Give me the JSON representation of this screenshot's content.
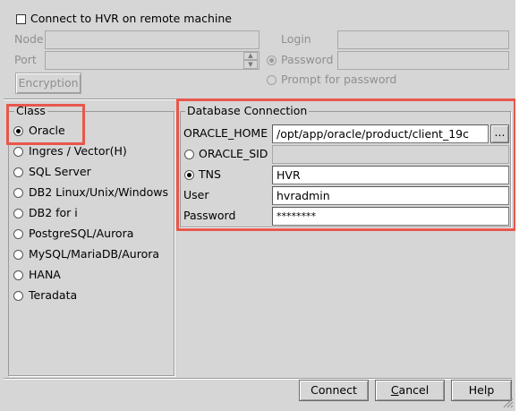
{
  "remote": {
    "connect_checkbox_label": "Connect to HVR on remote machine",
    "connect_checked": false,
    "node_label": "Node",
    "node_value": "",
    "port_label": "Port",
    "port_value": "",
    "login_label": "Login",
    "login_value": "",
    "password_label": "Password",
    "password_value": "",
    "prompt_label": "Prompt for password",
    "encryption_button": "Encryption"
  },
  "class_group": {
    "title": "Class",
    "selected": "Oracle",
    "options": [
      "Oracle",
      "Ingres / Vector(H)",
      "SQL Server",
      "DB2 Linux/Unix/Windows",
      "DB2 for i",
      "PostgreSQL/Aurora",
      "MySQL/MariaDB/Aurora",
      "HANA",
      "Teradata"
    ]
  },
  "db_connection": {
    "title": "Database Connection",
    "oracle_home_label": "ORACLE_HOME",
    "oracle_home_value": "/opt/app/oracle/product/client_19c",
    "browse_button": "...",
    "oracle_sid_label": "ORACLE_SID",
    "oracle_sid_value": "",
    "tns_label": "TNS",
    "tns_value": "HVR",
    "user_label": "User",
    "user_value": "hvradmin",
    "password_label": "Password",
    "password_value": "********",
    "selected_mode": "TNS"
  },
  "buttons": {
    "connect": "Connect",
    "cancel": "Cancel",
    "help": "Help"
  },
  "colors": {
    "highlight": "#e8574b",
    "window_bg": "#d6d6d6"
  }
}
